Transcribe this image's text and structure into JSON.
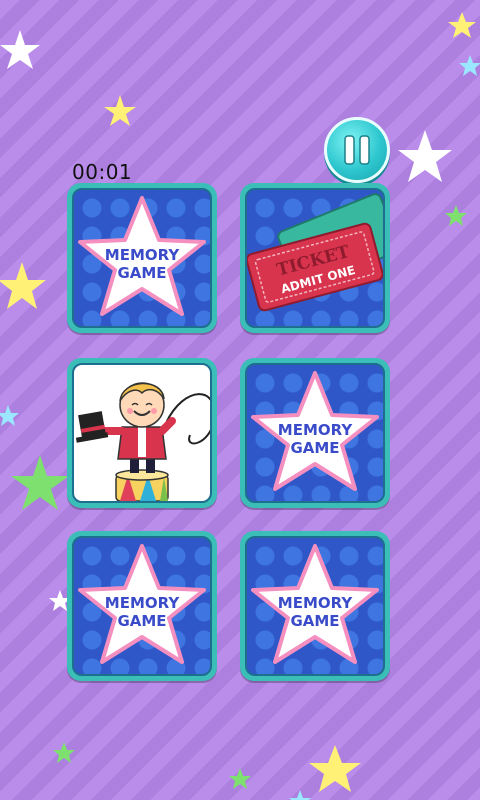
{
  "timer": "00:01",
  "colors": {
    "card_border": "#3bbdb8",
    "card_back": "#2f57c8",
    "star_text": "#3a4bc9",
    "accent_pink": "#e05a9c"
  },
  "cards": [
    {
      "state": "face-down",
      "label_line1": "MEMORY",
      "label_line2": "GAME"
    },
    {
      "state": "revealed",
      "image": "ticket",
      "ticket_title": "TICKET",
      "ticket_sub": "ADMIT ONE"
    },
    {
      "state": "revealed",
      "image": "ringmaster-boy"
    },
    {
      "state": "face-down",
      "label_line1": "MEMORY",
      "label_line2": "GAME"
    },
    {
      "state": "face-down",
      "label_line1": "MEMORY",
      "label_line2": "GAME"
    },
    {
      "state": "face-down",
      "label_line1": "MEMORY",
      "label_line2": "GAME"
    }
  ],
  "icons": {
    "pause": "pause-icon"
  }
}
